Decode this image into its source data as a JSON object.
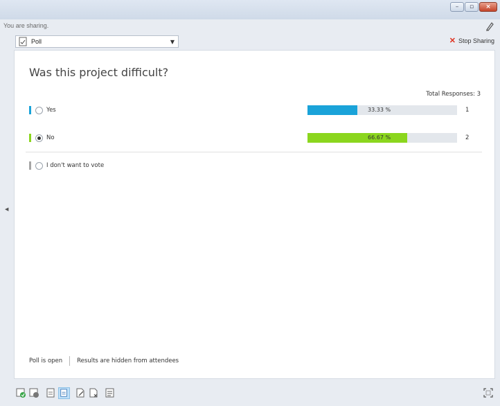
{
  "window": {
    "sharing_status": "You are sharing.",
    "poll_selector": "Poll",
    "stop_sharing": "Stop Sharing"
  },
  "poll": {
    "question": "Was this project difficult?",
    "total_responses": "Total Responses: 3",
    "options": [
      {
        "label": "Yes",
        "percent_text": "33.33 %",
        "percent": 33.33,
        "count": "1",
        "color": "#1aa3d9",
        "selected": false,
        "has_results": true
      },
      {
        "label": "No",
        "percent_text": "66.67 %",
        "percent": 66.67,
        "count": "2",
        "color": "#8bd61e",
        "selected": true,
        "has_results": true
      },
      {
        "label": "I don't want to vote",
        "color": "#a6a6a6",
        "selected": false,
        "has_results": false
      }
    ],
    "status_open": "Poll is open",
    "status_results": "Results are hidden from attendees"
  },
  "colors": {
    "accent_blue": "#1aa3d9",
    "accent_green": "#8bd61e",
    "stop_red": "#e0301e"
  },
  "bottom_toolbar": {
    "icons": [
      "open-poll-icon",
      "close-poll-icon",
      "show-results-icon",
      "hide-results-icon",
      "edit-poll-icon",
      "delete-poll-icon",
      "poll-list-icon"
    ],
    "active_icon": "hide-results-icon"
  }
}
